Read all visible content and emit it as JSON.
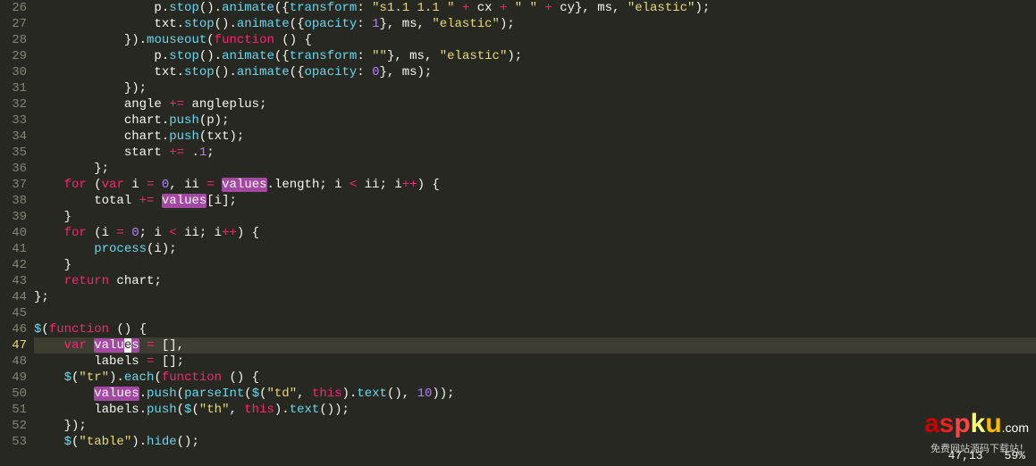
{
  "gutter": {
    "start": 26,
    "end": 53,
    "current": 47
  },
  "lines": {
    "l26": {
      "i": "                ",
      "t1": "p.",
      "fn": "stop",
      "t2": "().",
      "fn2": "animate",
      "t3": "({",
      "prop": "transform",
      "t4": ": ",
      "str": "\"s1.1 1.1 \"",
      "t5": " ",
      "op": "+",
      "t6": " cx ",
      "op2": "+",
      "t7": " ",
      "str2": "\" \"",
      "t8": " ",
      "op3": "+",
      "t9": " cy}, ms, ",
      "str3": "\"elastic\"",
      "t10": ");"
    },
    "l27": {
      "i": "                ",
      "t1": "txt.",
      "fn": "stop",
      "t2": "().",
      "fn2": "animate",
      "t3": "({",
      "prop": "opacity",
      "t4": ": ",
      "num": "1",
      "t5": "}, ms, ",
      "str": "\"elastic\"",
      "t6": ");"
    },
    "l28": {
      "i": "            ",
      "t1": "}).",
      "fn": "mouseout",
      "t2": "(",
      "kw": "function",
      "t3": " () {"
    },
    "l29": {
      "i": "                ",
      "t1": "p.",
      "fn": "stop",
      "t2": "().",
      "fn2": "animate",
      "t3": "({",
      "prop": "transform",
      "t4": ": ",
      "str": "\"\"",
      "t5": "}, ms, ",
      "str2": "\"elastic\"",
      "t6": ");"
    },
    "l30": {
      "i": "                ",
      "t1": "txt.",
      "fn": "stop",
      "t2": "().",
      "fn2": "animate",
      "t3": "({",
      "prop": "opacity",
      "t4": ": ",
      "num": "0",
      "t5": "}, ms);"
    },
    "l31": {
      "i": "            ",
      "t1": "});"
    },
    "l32": {
      "i": "            ",
      "t1": "angle ",
      "op": "+=",
      "t2": " angleplus;"
    },
    "l33": {
      "i": "            ",
      "t1": "chart.",
      "fn": "push",
      "t2": "(p);"
    },
    "l34": {
      "i": "            ",
      "t1": "chart.",
      "fn": "push",
      "t2": "(txt);"
    },
    "l35": {
      "i": "            ",
      "t1": "start ",
      "op": "+=",
      "t2": " .",
      "num": "1",
      "t3": ";"
    },
    "l36": {
      "i": "        ",
      "t1": "};"
    },
    "l37": {
      "i": "    ",
      "kw": "for",
      "t1": " (",
      "kw2": "var",
      "t2": " i ",
      "op": "=",
      "t3": " ",
      "num": "0",
      "t4": ", ii ",
      "op2": "=",
      "t5": " ",
      "hl": "values",
      "t6": ".length; i ",
      "op3": "<",
      "t7": " ii; i",
      "op4": "++",
      "t8": ") {"
    },
    "l38": {
      "i": "        ",
      "t1": "total ",
      "op": "+=",
      "t2": " ",
      "hl": "values",
      "t3": "[i];"
    },
    "l39": {
      "i": "    ",
      "t1": "}"
    },
    "l40": {
      "i": "    ",
      "kw": "for",
      "t1": " (i ",
      "op": "=",
      "t2": " ",
      "num": "0",
      "t3": "; i ",
      "op2": "<",
      "t4": " ii; i",
      "op3": "++",
      "t5": ") {"
    },
    "l41": {
      "i": "        ",
      "fn": "process",
      "t1": "(i);"
    },
    "l42": {
      "i": "    ",
      "t1": "}"
    },
    "l43": {
      "i": "    ",
      "kw": "return",
      "t1": " chart;"
    },
    "l44": {
      "i": "",
      "t1": "};"
    },
    "l45": {
      "i": "",
      "t1": ""
    },
    "l46": {
      "i": "",
      "fn": "$",
      "t1": "(",
      "kw": "function",
      "t2": " () {"
    },
    "l47": {
      "i": "    ",
      "kw": "var",
      "t1": " ",
      "hl": "valu",
      "cur": "e",
      "hl2": "s",
      "t2": " ",
      "op": "=",
      "t3": " [],"
    },
    "l48": {
      "i": "        ",
      "t1": "labels ",
      "op": "=",
      "t2": " [];"
    },
    "l49": {
      "i": "    ",
      "fn": "$",
      "t1": "(",
      "str": "\"tr\"",
      "t2": ").",
      "fn2": "each",
      "t3": "(",
      "kw": "function",
      "t4": " () {"
    },
    "l50": {
      "i": "        ",
      "hl": "values",
      "t1": ".",
      "fn": "push",
      "t2": "(",
      "fn2": "parseInt",
      "t3": "(",
      "fn3": "$",
      "t4": "(",
      "str": "\"td\"",
      "t5": ", ",
      "kw": "this",
      "t6": ").",
      "fn4": "text",
      "t7": "(), ",
      "num": "10",
      "t8": "));"
    },
    "l51": {
      "i": "        ",
      "t1": "labels.",
      "fn": "push",
      "t2": "(",
      "fn2": "$",
      "t3": "(",
      "str": "\"th\"",
      "t4": ", ",
      "kw": "this",
      "t5": ").",
      "fn3": "text",
      "t6": "());"
    },
    "l52": {
      "i": "    ",
      "t1": "});"
    },
    "l53": {
      "i": "    ",
      "fn": "$",
      "t1": "(",
      "str": "\"table\"",
      "t2": ").",
      "fn2": "hide",
      "t3": "();"
    }
  },
  "status": {
    "pos": "47,13",
    "pct": "59%"
  },
  "watermark": {
    "l1": "a",
    "l2": "s",
    "l3": "p",
    "l4": "k",
    "l5": "u",
    "dom": ".com",
    "sub": "免费网站源码下载站！"
  }
}
